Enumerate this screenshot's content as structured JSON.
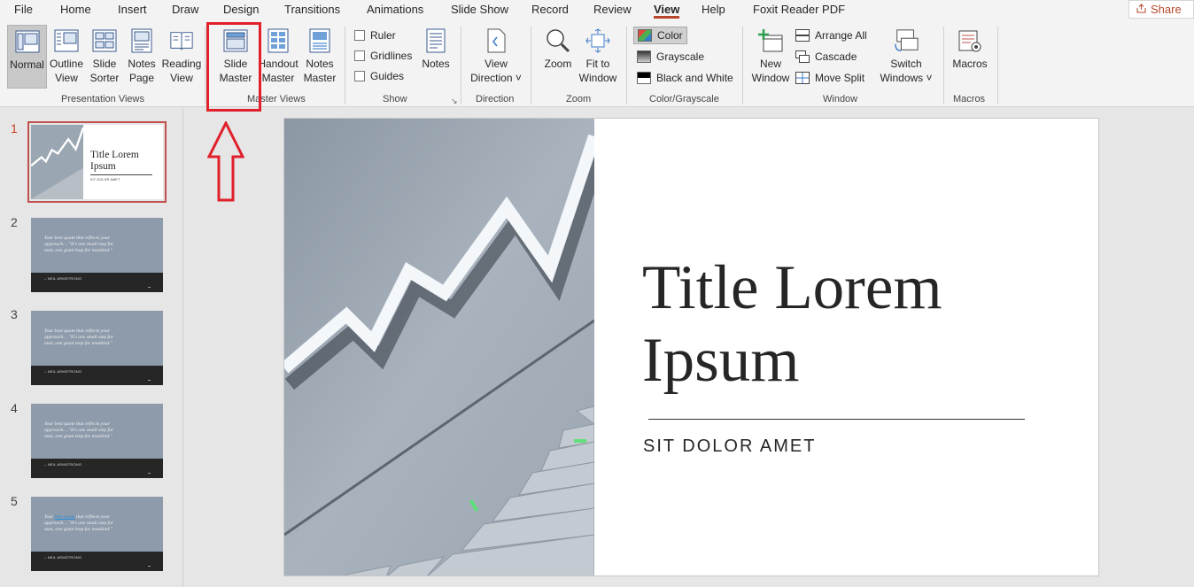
{
  "tabs": [
    "File",
    "Home",
    "Insert",
    "Draw",
    "Design",
    "Transitions",
    "Animations",
    "Slide Show",
    "Record",
    "Review",
    "View",
    "Help",
    "Foxit Reader PDF"
  ],
  "active_tab": "View",
  "share_label": "Share",
  "ribbon": {
    "presentation_views": {
      "group_label": "Presentation Views",
      "normal": "Normal",
      "outline_view": [
        "Outline",
        "View"
      ],
      "slide_sorter": [
        "Slide",
        "Sorter"
      ],
      "notes_page": [
        "Notes",
        "Page"
      ],
      "reading_view": [
        "Reading",
        "View"
      ]
    },
    "master_views": {
      "group_label": "Master Views",
      "slide_master": [
        "Slide",
        "Master"
      ],
      "handout_master": [
        "Handout",
        "Master"
      ],
      "notes_master": [
        "Notes",
        "Master"
      ]
    },
    "show": {
      "group_label": "Show",
      "ruler": "Ruler",
      "gridlines": "Gridlines",
      "guides": "Guides",
      "notes": "Notes"
    },
    "direction": {
      "group_label": "Direction",
      "view_direction": [
        "View",
        "Direction"
      ]
    },
    "zoom": {
      "group_label": "Zoom",
      "zoom": "Zoom",
      "fit_to_window": [
        "Fit to",
        "Window"
      ]
    },
    "color_grayscale": {
      "group_label": "Color/Grayscale",
      "color": "Color",
      "grayscale": "Grayscale",
      "black_and_white": "Black and White"
    },
    "window": {
      "group_label": "Window",
      "new_window": [
        "New",
        "Window"
      ],
      "arrange_all": "Arrange All",
      "cascade": "Cascade",
      "move_split": "Move Split",
      "switch_windows": [
        "Switch",
        "Windows"
      ]
    },
    "macros": {
      "group_label": "Macros",
      "macros": "Macros"
    }
  },
  "thumbnails": [
    {
      "num": "1",
      "title": [
        "Title Lorem",
        "Ipsum"
      ],
      "subtitle": "SIT DOLOR AMET"
    },
    {
      "num": "2",
      "quote": [
        "Your best quote that reflects your",
        "approach… \"It's one small step for",
        "man, one giant leap for mankind.\""
      ],
      "author": "– NEIL ARMSTRONG"
    },
    {
      "num": "3",
      "quote": [
        "Your best quote that reflects your",
        "approach… \"It's one small step for",
        "man, one giant leap for mankind.\""
      ],
      "author": "– NEIL ARMSTRONG"
    },
    {
      "num": "4",
      "quote": [
        "Your best quote that reflects your",
        "approach… \"It's one small step for",
        "man, one giant leap for mankind.\""
      ],
      "author": "– NEIL ARMSTRONG"
    },
    {
      "num": "5",
      "quote_prefix": "Your",
      "quote_link": "best quote",
      "quote_rest": "that reflects your",
      "quote": [
        "",
        "approach… \"It's one small step for",
        "man, one giant leap for mankind.\""
      ],
      "author": "– NEIL ARMSTRONG"
    }
  ],
  "slide": {
    "title": [
      "Title Lorem",
      "Ipsum"
    ],
    "subtitle": "SIT DOLOR AMET"
  },
  "colors": {
    "accent": "#b7472a",
    "annotation": "#e0202a",
    "thumb_selected": "#c0504d"
  }
}
